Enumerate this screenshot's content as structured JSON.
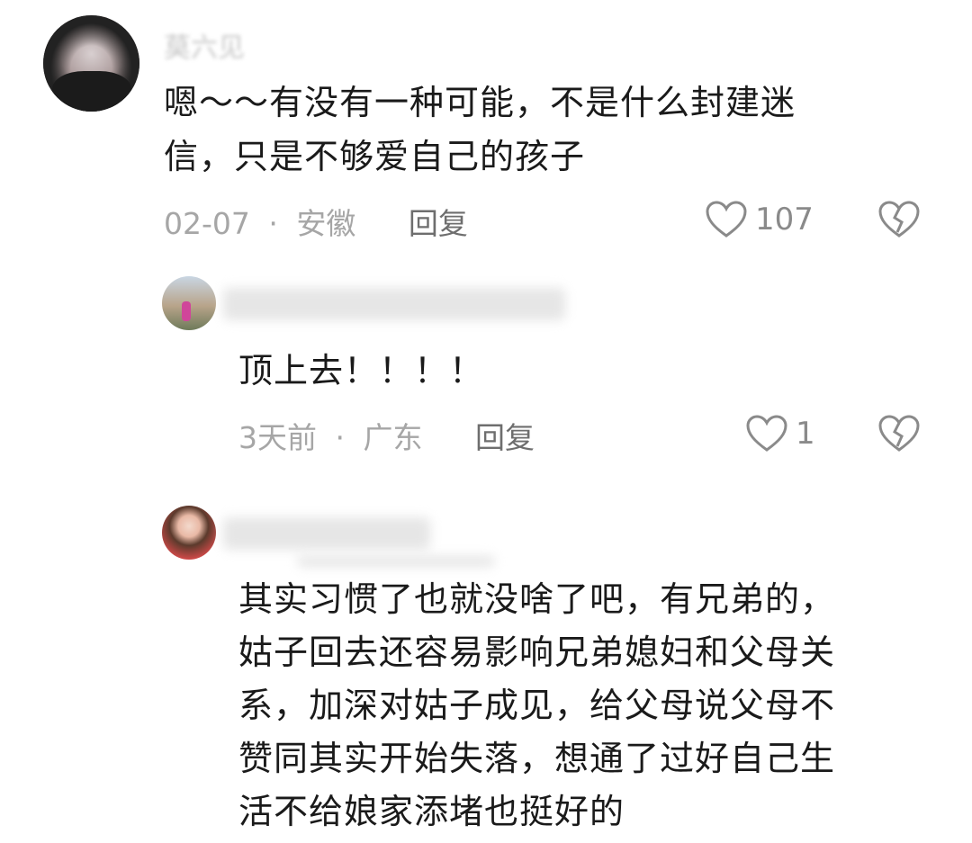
{
  "comments": [
    {
      "name": "莫六见",
      "text": "嗯～～有没有一种可能，不是什么封建迷信，只是不够爱自己的孩子",
      "line1": "嗯～～有没有一种可能，不是什么封建迷",
      "line2": "信，只是不够爱自己的孩子",
      "date": "02-07",
      "location": "安徽",
      "reply_label": "回复",
      "likes": "107"
    },
    {
      "text": "顶上去！！！！",
      "date": "3天前",
      "location": "广东",
      "reply_label": "回复",
      "likes": "1"
    },
    {
      "lines": [
        "其实习惯了也就没啥了吧，有兄弟的，",
        "姑子回去还容易影响兄弟媳妇和父母关",
        "系，加深对姑子成见，给父母说父母不",
        "赞同其实开始失落，想通了过好自己生",
        "活不给娘家添堵也挺好的"
      ]
    }
  ],
  "separator": "·",
  "icons": {
    "like": "heart-outline-icon",
    "dislike": "broken-heart-icon"
  },
  "colors": {
    "text": "#1a1a1a",
    "meta": "#a6a6a6",
    "reply": "#6e6e6e",
    "icon": "#8a8a8a"
  }
}
